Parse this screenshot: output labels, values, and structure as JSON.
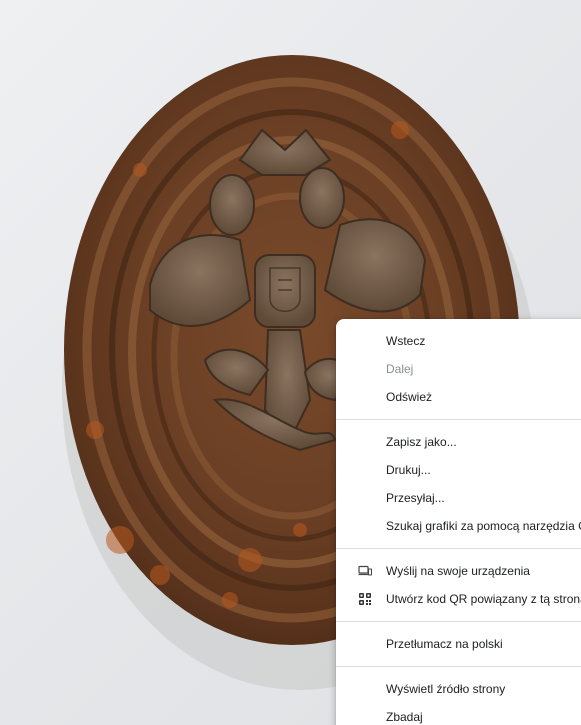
{
  "context_menu": {
    "items": [
      {
        "label": "Wstecz",
        "enabled": true
      },
      {
        "label": "Dalej",
        "enabled": false
      },
      {
        "label": "Odśwież",
        "enabled": true
      },
      {
        "label": "Zapisz jako...",
        "enabled": true
      },
      {
        "label": "Drukuj...",
        "enabled": true
      },
      {
        "label": "Przesyłaj...",
        "enabled": true
      },
      {
        "label": "Szukaj grafiki za pomocą narzędzia Google Lens",
        "enabled": true
      },
      {
        "label": "Wyślij na swoje urządzenia",
        "enabled": true,
        "icon": "devices-icon"
      },
      {
        "label": "Utwórz kod QR powiązany z tą stroną",
        "enabled": true,
        "icon": "qr-code-icon"
      },
      {
        "label": "Przetłumacz na polski",
        "enabled": true
      },
      {
        "label": "Wyświetl źródło strony",
        "enabled": true
      },
      {
        "label": "Zbadaj",
        "enabled": true
      }
    ]
  }
}
